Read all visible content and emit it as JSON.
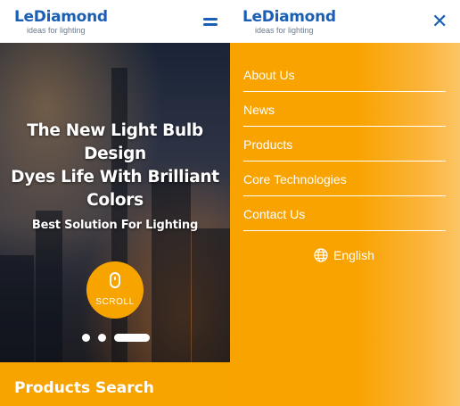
{
  "brand": {
    "name": "LeDiamond",
    "tagline": "ideas for lighting",
    "color": "#1a5fb4"
  },
  "accent_color": "#f7a400",
  "header": {
    "menu_icon": "hamburger-icon",
    "close_icon": "close-icon",
    "close_glyph": "✕"
  },
  "hero": {
    "title_line1": "The New Light Bulb",
    "title_line2": "Design",
    "title_line3": "Dyes Life With Brilliant",
    "title_line4": "Colors",
    "subtitle": "Best Solution For Lighting",
    "scroll_label": "SCROLL",
    "scroll_icon": "mouse-icon",
    "slides": 3,
    "active_slide": 3
  },
  "products": {
    "title": "Products Search"
  },
  "menu": {
    "items": [
      {
        "label": "About Us"
      },
      {
        "label": "News"
      },
      {
        "label": "Products"
      },
      {
        "label": "Core Technologies"
      },
      {
        "label": "Contact Us"
      }
    ],
    "language": {
      "icon": "globe-icon",
      "label": "English"
    }
  }
}
